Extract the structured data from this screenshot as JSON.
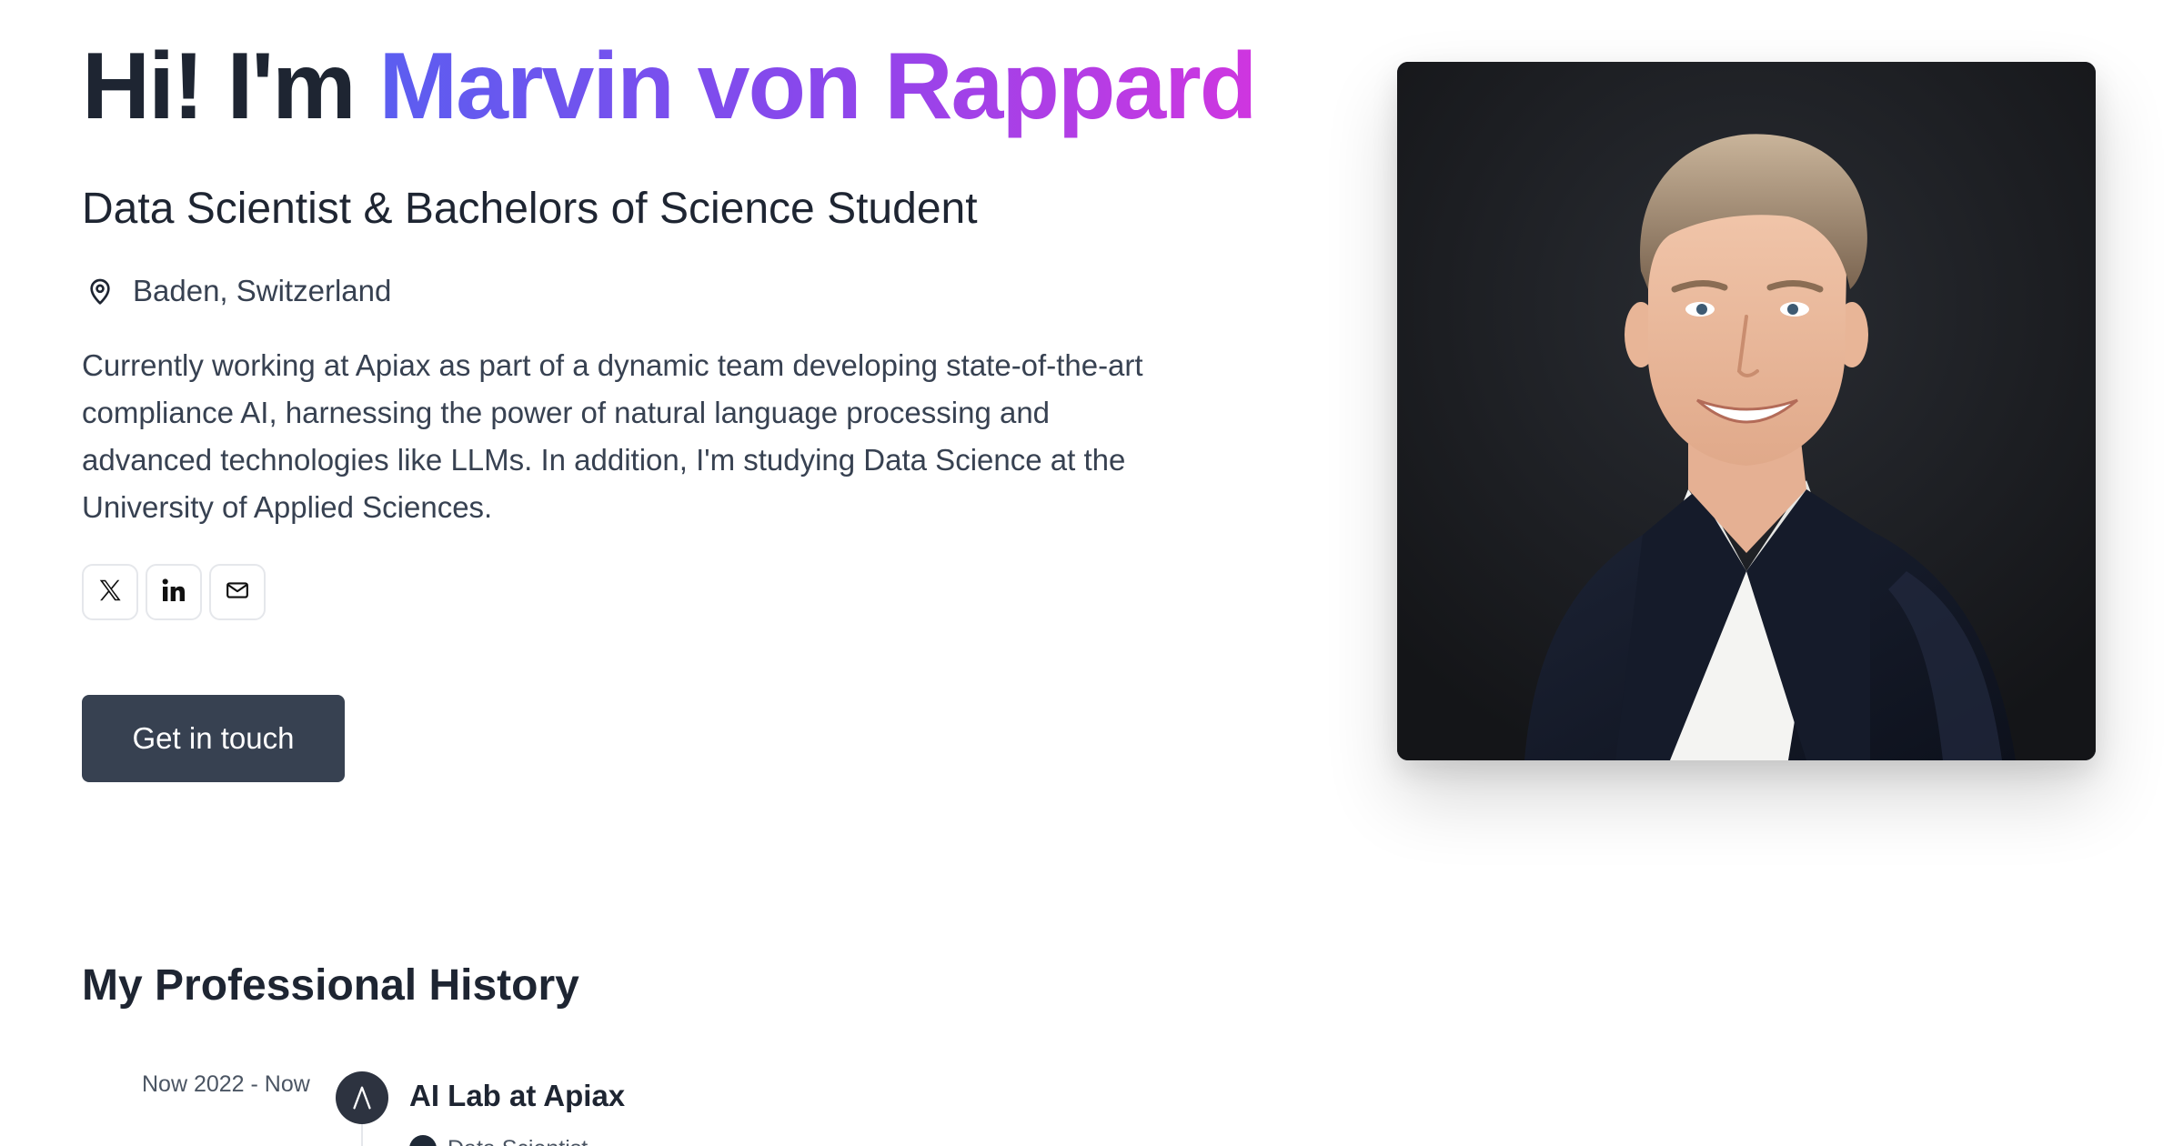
{
  "hero": {
    "greeting": "Hi! I'm ",
    "name": "Marvin von Rappard",
    "subtitle": "Data Scientist & Bachelors of Science Student",
    "location": "Baden, Switzerland",
    "bio": "Currently working at Apiax as part of a dynamic team developing state-of-the-art compliance AI, harnessing the power of natural language processing and advanced technologies like LLMs. In addition, I'm studying Data Science at the University of Applied Sciences.",
    "cta_label": "Get in touch",
    "gradient_colors": [
      "#5b5ef0",
      "#8a47ec",
      "#cf36e0"
    ]
  },
  "socials": [
    {
      "icon": "x-icon"
    },
    {
      "icon": "linkedin-icon"
    },
    {
      "icon": "mail-icon"
    }
  ],
  "history": {
    "title": "My Professional History",
    "items": [
      {
        "date": "Now 2022 - Now",
        "company": "AI Lab at Apiax",
        "role": "Data Scientist"
      }
    ]
  },
  "colors": {
    "text_primary": "#1e2532",
    "text_secondary": "#374151",
    "button_bg": "#374151"
  }
}
